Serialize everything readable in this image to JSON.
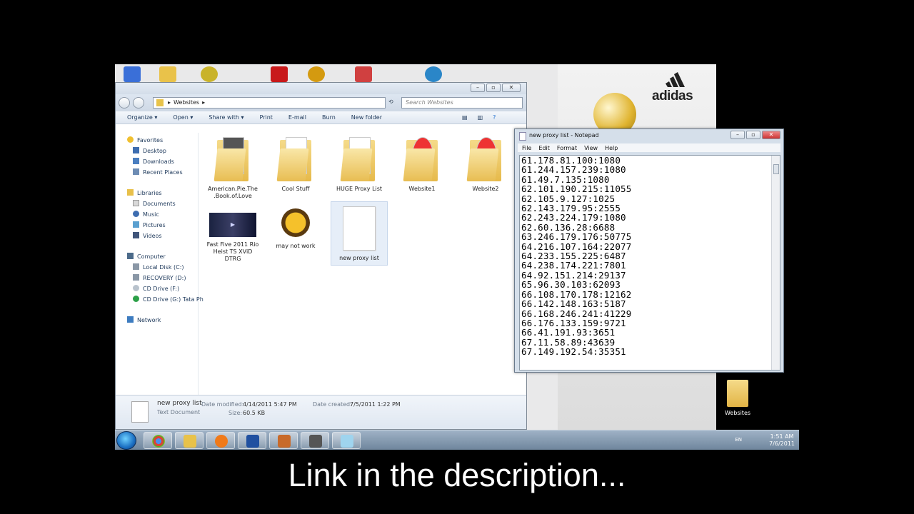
{
  "explorer": {
    "breadcrumb": "Websites",
    "search_placeholder": "Search Websites",
    "toolbar": [
      "Organize ▾",
      "Open ▾",
      "Share with ▾",
      "Print",
      "E-mail",
      "Burn",
      "New folder"
    ],
    "nav": {
      "favorites": "Favorites",
      "desktop": "Desktop",
      "downloads": "Downloads",
      "recent": "Recent Places",
      "libraries": "Libraries",
      "documents": "Documents",
      "music": "Music",
      "pictures": "Pictures",
      "videos": "Videos",
      "computer": "Computer",
      "local_disk": "Local Disk (C:)",
      "recovery": "RECOVERY (D:)",
      "cd_f": "CD Drive (F:)",
      "cd_g": "CD Drive (G:) Tata Ph",
      "network": "Network"
    },
    "files": [
      {
        "name": "American.Pie.The .Book.of.Love"
      },
      {
        "name": "Cool Stuff"
      },
      {
        "name": "HUGE Proxy List"
      },
      {
        "name": "Website1"
      },
      {
        "name": "Website2"
      },
      {
        "name": "Fast Five 2011 Rio Heist TS XViD DTRG"
      },
      {
        "name": "may not work"
      },
      {
        "name": "new proxy list"
      }
    ],
    "details": {
      "name": "new proxy list",
      "type": "Text Document",
      "modified_label": "Date modified:",
      "modified": "4/14/2011 5:47 PM",
      "size_label": "Size:",
      "size": "60.5 KB",
      "created_label": "Date created:",
      "created": "7/5/2011 1:22 PM"
    }
  },
  "notepad": {
    "title": "new proxy list - Notepad",
    "menu": [
      "File",
      "Edit",
      "Format",
      "View",
      "Help"
    ],
    "lines": [
      "61.178.81.100:1080",
      "61.244.157.239:1080",
      "61.49.7.135:1080",
      "62.101.190.215:11055",
      "62.105.9.127:1025",
      "62.143.179.95:2555",
      "62.243.224.179:1080",
      "62.60.136.28:6688",
      "63.246.179.176:50775",
      "64.216.107.164:22077",
      "64.233.155.225:6487",
      "64.238.174.221:7801",
      "64.92.151.214:29137",
      "65.96.30.103:62093",
      "66.108.170.178:12162",
      "66.142.148.163:5187",
      "66.168.246.241:41229",
      "66.176.133.159:9721",
      "66.41.191.93:3651",
      "67.11.58.89:43639",
      "67.149.192.54:35351"
    ]
  },
  "desktop": {
    "icon_label": "Websites",
    "brand": "adidas"
  },
  "taskbar": {
    "lang": "EN",
    "time": "1:51 AM",
    "date": "7/6/2011"
  },
  "caption": "Link in the description..."
}
